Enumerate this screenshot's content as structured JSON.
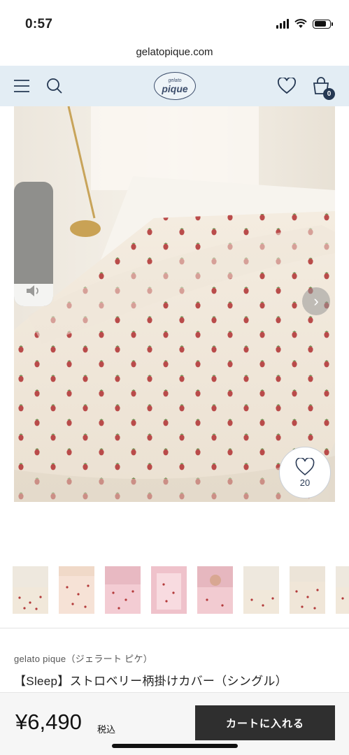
{
  "status": {
    "time": "0:57"
  },
  "browser": {
    "url": "gelatopique.com"
  },
  "header": {
    "logo_small": "gelato",
    "logo_big": "pique",
    "cart_count": "0"
  },
  "hero": {
    "favorite_count": "20"
  },
  "volume": {
    "level": 0.18
  },
  "product": {
    "brand": "gelato pique（ジェラート ピケ）",
    "title": "【Sleep】ストロベリー柄掛けカバー（シングル）",
    "price": "¥6,490",
    "tax_label": "税込",
    "cart_button": "カートに入れる"
  },
  "colors": {
    "header_bg": "#e3edf4",
    "navy": "#253853",
    "button_bg": "#2f2f2f"
  }
}
